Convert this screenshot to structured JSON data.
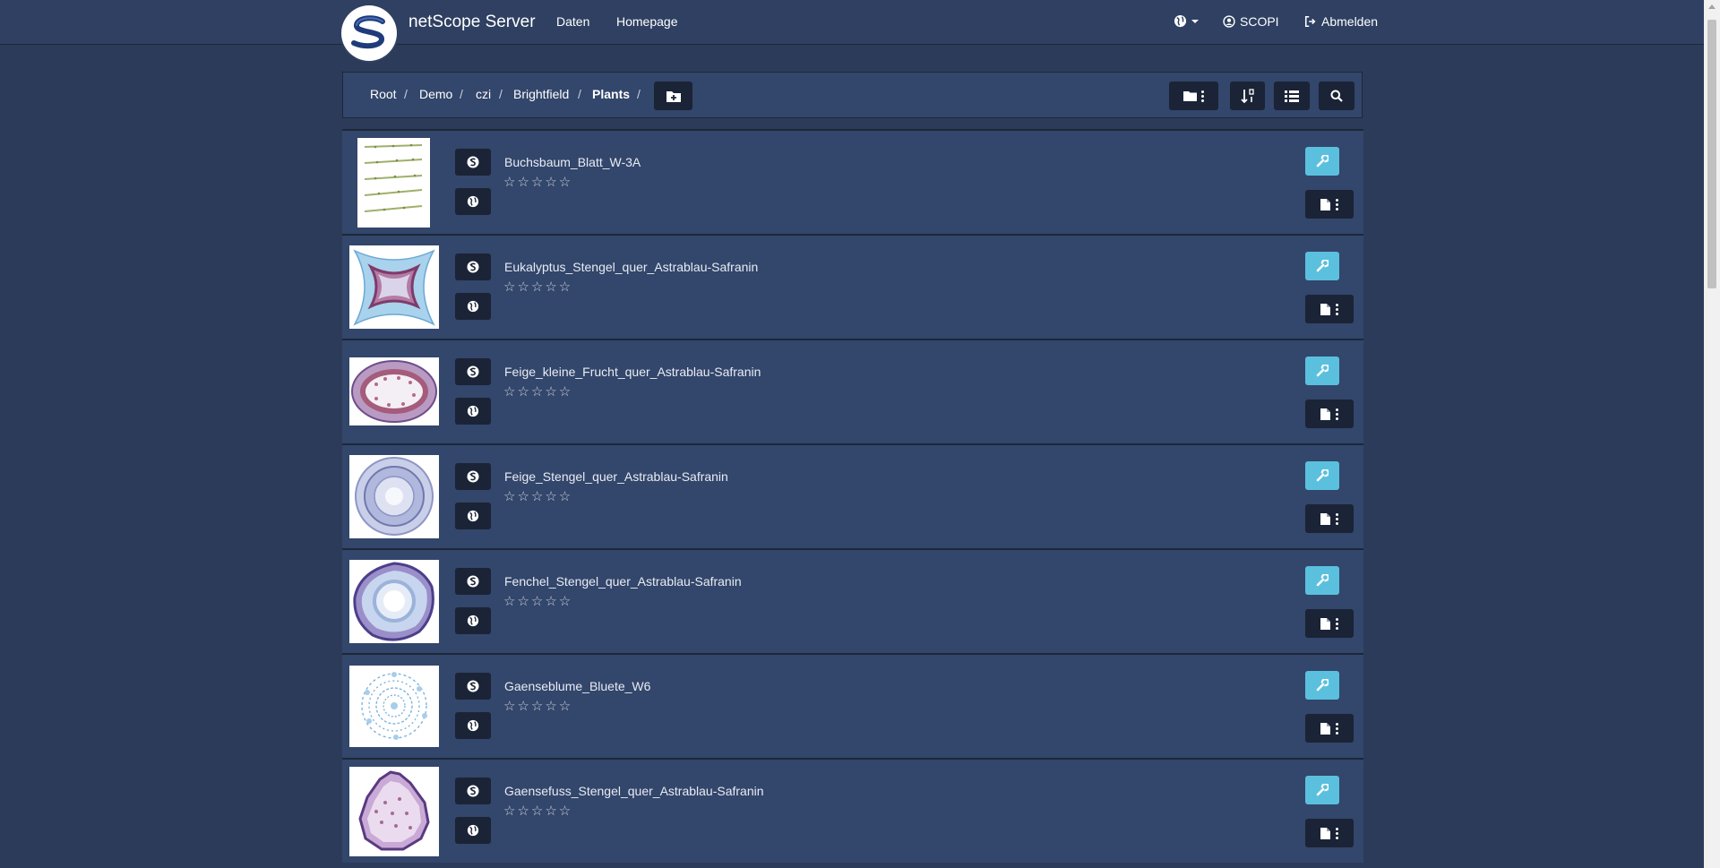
{
  "navbar": {
    "brand": "netScope Server",
    "links": [
      "Daten",
      "Homepage"
    ],
    "user_label": "SCOPI",
    "logout_label": "Abmelden"
  },
  "breadcrumb": [
    "Root",
    "Demo",
    "czi",
    "Brightfield",
    "Plants"
  ],
  "breadcrumb_separator": "/",
  "items": [
    {
      "name": "Buchsbaum_Blatt_W-3A",
      "rating": "☆☆☆☆☆"
    },
    {
      "name": "Eukalyptus_Stengel_quer_Astrablau-Safranin",
      "rating": "☆☆☆☆☆"
    },
    {
      "name": "Feige_kleine_Frucht_quer_Astrablau-Safranin",
      "rating": "☆☆☆☆☆"
    },
    {
      "name": "Feige_Stengel_quer_Astrablau-Safranin",
      "rating": "☆☆☆☆☆"
    },
    {
      "name": "Fenchel_Stengel_quer_Astrablau-Safranin",
      "rating": "☆☆☆☆☆"
    },
    {
      "name": "Gaenseblume_Bluete_W6",
      "rating": "☆☆☆☆☆"
    },
    {
      "name": "Gaensefuss_Stengel_quer_Astrablau-Safranin",
      "rating": "☆☆☆☆☆"
    }
  ],
  "icons": {
    "language": "globe-icon",
    "user": "user-circle-icon",
    "logout": "sign-out-icon",
    "new_folder": "folder-plus-icon",
    "folder_menu": "folder-icon",
    "sort": "sort-icon",
    "list_view": "list-icon",
    "search": "search-icon",
    "viewer": "viewer-icon",
    "share": "globe-icon",
    "settings": "wrench-icon",
    "file_menu": "file-icon"
  },
  "colors": {
    "background": "#2c3b59",
    "navbar": "#2f4062",
    "row": "#33466b",
    "button_dark": "#1b2336",
    "accent": "#5bc0de"
  }
}
